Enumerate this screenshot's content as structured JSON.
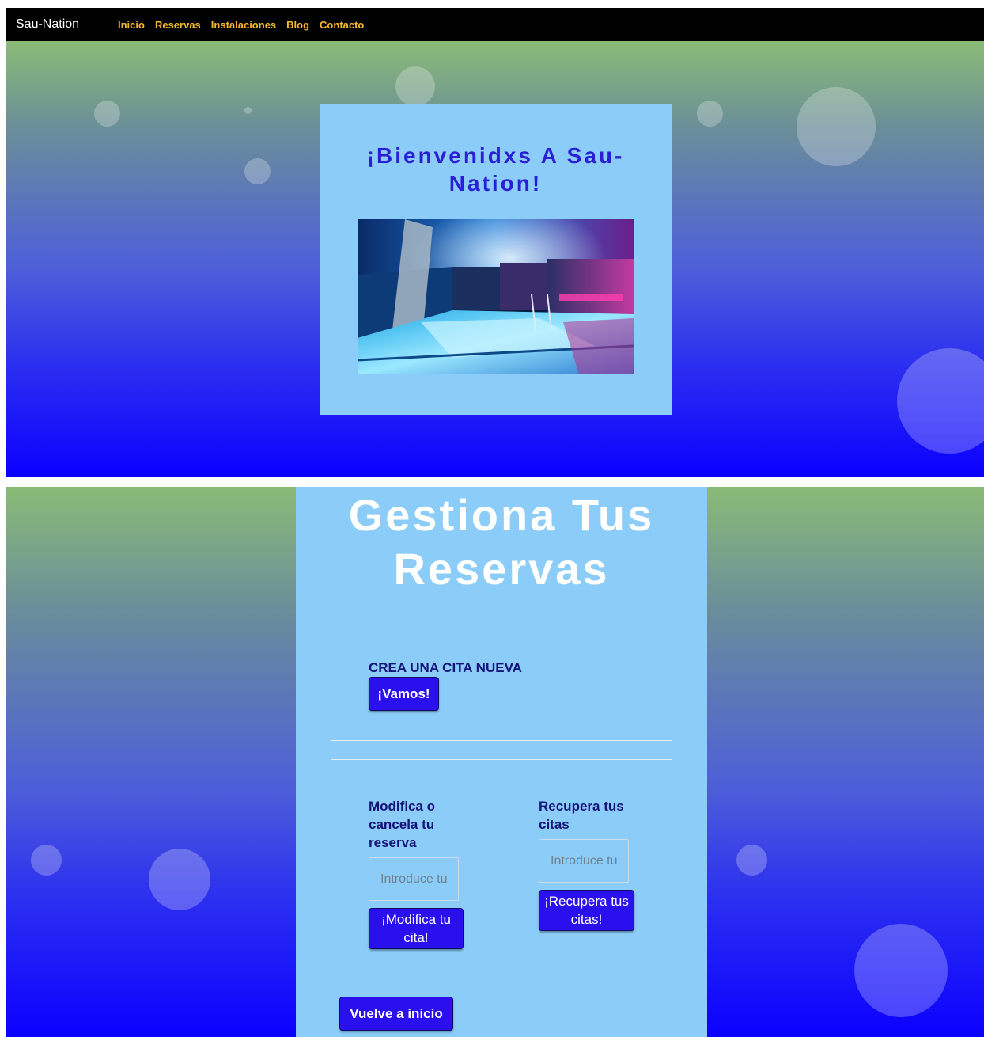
{
  "navbar": {
    "brand": "Sau-Nation",
    "links": [
      "Inicio",
      "Reservas",
      "Instalaciones",
      "Blog",
      "Contacto"
    ]
  },
  "hero": {
    "title": "¡Bienvenidxs A Sau-Nation!"
  },
  "reservas": {
    "title": "Gestiona Tus Reservas",
    "create": {
      "heading": "CREA UNA CITA NUEVA",
      "button": "¡Vamos!"
    },
    "modify": {
      "heading": "Modifica o cancela tu reserva",
      "placeholder": "Introduce tu",
      "button": "¡Modifica tu cita!"
    },
    "recover": {
      "heading": "Recupera tus citas",
      "placeholder": "Introduce tu",
      "button": "¡Recupera tus citas!"
    },
    "back_button": "Vuelve a inicio"
  },
  "colors": {
    "nav_link": "#f5b82e",
    "card_bg": "#8bcdf8",
    "title_blue": "#2a1ed6",
    "button_bg": "#2a10ef",
    "heading_navy": "#14137a"
  }
}
